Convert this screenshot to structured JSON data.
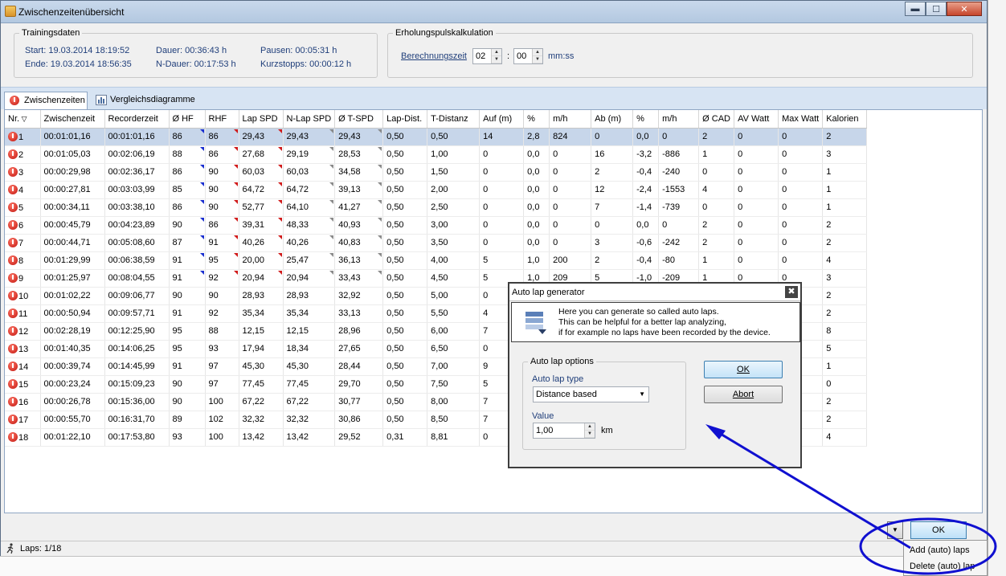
{
  "window": {
    "title": "Zwischenzeitenübersicht"
  },
  "training": {
    "legend": "Trainingsdaten",
    "start": "Start: 19.03.2014 18:19:52",
    "ende": "Ende: 19.03.2014 18:56:35",
    "dauer": "Dauer: 00:36:43 h",
    "ndauer": "N-Dauer: 00:17:53 h",
    "pausen": "Pausen: 00:05:31 h",
    "kurzstopps": "Kurzstopps: 00:00:12 h"
  },
  "erholung": {
    "legend": "Erholungspulskalkulation",
    "label": "Berechnungszeit",
    "min": "02",
    "sep": ":",
    "sec": "00",
    "unit": "mm:ss"
  },
  "tabs": [
    "Zwischenzeiten",
    "Vergleichsdiagramme"
  ],
  "columns": [
    "Nr.",
    "Zwischenzeit",
    "Recorderzeit",
    "Ø HF",
    "RHF",
    "Lap SPD",
    "N-Lap SPD",
    "Ø T-SPD",
    "Lap-Dist.",
    "T-Distanz",
    "Auf (m)",
    "%",
    "m/h",
    "Ab (m)",
    "%",
    "m/h",
    "Ø CAD",
    "AV Watt",
    "Max Watt",
    "Kalorien"
  ],
  "rows": [
    [
      "1",
      "00:01:01,16",
      "00:01:01,16",
      "86",
      "86",
      "29,43",
      "29,43",
      "29,43",
      "0,50",
      "0,50",
      "14",
      "2,8",
      "824",
      "0",
      "0,0",
      "0",
      "2",
      "0",
      "0",
      "2"
    ],
    [
      "2",
      "00:01:05,03",
      "00:02:06,19",
      "88",
      "86",
      "27,68",
      "29,19",
      "28,53",
      "0,50",
      "1,00",
      "0",
      "0,0",
      "0",
      "16",
      "-3,2",
      "-886",
      "1",
      "0",
      "0",
      "3"
    ],
    [
      "3",
      "00:00:29,98",
      "00:02:36,17",
      "86",
      "90",
      "60,03",
      "60,03",
      "34,58",
      "0,50",
      "1,50",
      "0",
      "0,0",
      "0",
      "2",
      "-0,4",
      "-240",
      "0",
      "0",
      "0",
      "1"
    ],
    [
      "4",
      "00:00:27,81",
      "00:03:03,99",
      "85",
      "90",
      "64,72",
      "64,72",
      "39,13",
      "0,50",
      "2,00",
      "0",
      "0,0",
      "0",
      "12",
      "-2,4",
      "-1553",
      "4",
      "0",
      "0",
      "1"
    ],
    [
      "5",
      "00:00:34,11",
      "00:03:38,10",
      "86",
      "90",
      "52,77",
      "64,10",
      "41,27",
      "0,50",
      "2,50",
      "0",
      "0,0",
      "0",
      "7",
      "-1,4",
      "-739",
      "0",
      "0",
      "0",
      "1"
    ],
    [
      "6",
      "00:00:45,79",
      "00:04:23,89",
      "90",
      "86",
      "39,31",
      "48,33",
      "40,93",
      "0,50",
      "3,00",
      "0",
      "0,0",
      "0",
      "0",
      "0,0",
      "0",
      "2",
      "0",
      "0",
      "2"
    ],
    [
      "7",
      "00:00:44,71",
      "00:05:08,60",
      "87",
      "91",
      "40,26",
      "40,26",
      "40,83",
      "0,50",
      "3,50",
      "0",
      "0,0",
      "0",
      "3",
      "-0,6",
      "-242",
      "2",
      "0",
      "0",
      "2"
    ],
    [
      "8",
      "00:01:29,99",
      "00:06:38,59",
      "91",
      "95",
      "20,00",
      "25,47",
      "36,13",
      "0,50",
      "4,00",
      "5",
      "1,0",
      "200",
      "2",
      "-0,4",
      "-80",
      "1",
      "0",
      "0",
      "4"
    ],
    [
      "9",
      "00:01:25,97",
      "00:08:04,55",
      "91",
      "92",
      "20,94",
      "20,94",
      "33,43",
      "0,50",
      "4,50",
      "5",
      "1,0",
      "209",
      "5",
      "-1,0",
      "-209",
      "1",
      "0",
      "0",
      "3"
    ],
    [
      "10",
      "00:01:02,22",
      "00:09:06,77",
      "90",
      "90",
      "28,93",
      "28,93",
      "32,92",
      "0,50",
      "5,00",
      "0",
      "",
      "",
      "",
      "",
      "",
      "",
      "",
      "",
      "2"
    ],
    [
      "11",
      "00:00:50,94",
      "00:09:57,71",
      "91",
      "92",
      "35,34",
      "35,34",
      "33,13",
      "0,50",
      "5,50",
      "4",
      "",
      "",
      "",
      "",
      "",
      "",
      "",
      "",
      "2"
    ],
    [
      "12",
      "00:02:28,19",
      "00:12:25,90",
      "95",
      "88",
      "12,15",
      "12,15",
      "28,96",
      "0,50",
      "6,00",
      "7",
      "",
      "",
      "",
      "",
      "",
      "",
      "",
      "",
      "8"
    ],
    [
      "13",
      "00:01:40,35",
      "00:14:06,25",
      "95",
      "93",
      "17,94",
      "18,34",
      "27,65",
      "0,50",
      "6,50",
      "0",
      "",
      "",
      "",
      "",
      "",
      "",
      "",
      "",
      "5"
    ],
    [
      "14",
      "00:00:39,74",
      "00:14:45,99",
      "91",
      "97",
      "45,30",
      "45,30",
      "28,44",
      "0,50",
      "7,00",
      "9",
      "",
      "",
      "",
      "",
      "",
      "",
      "",
      "",
      "1"
    ],
    [
      "15",
      "00:00:23,24",
      "00:15:09,23",
      "90",
      "97",
      "77,45",
      "77,45",
      "29,70",
      "0,50",
      "7,50",
      "5",
      "",
      "",
      "",
      "",
      "",
      "",
      "",
      "",
      "0"
    ],
    [
      "16",
      "00:00:26,78",
      "00:15:36,00",
      "90",
      "100",
      "67,22",
      "67,22",
      "30,77",
      "0,50",
      "8,00",
      "7",
      "",
      "",
      "",
      "",
      "",
      "",
      "",
      "",
      "2"
    ],
    [
      "17",
      "00:00:55,70",
      "00:16:31,70",
      "89",
      "102",
      "32,32",
      "32,32",
      "30,86",
      "0,50",
      "8,50",
      "7",
      "",
      "",
      "",
      "",
      "",
      "",
      "",
      "",
      "2"
    ],
    [
      "18",
      "00:01:22,10",
      "00:17:53,80",
      "93",
      "100",
      "13,42",
      "13,42",
      "29,52",
      "0,31",
      "8,81",
      "0",
      "",
      "",
      "",
      "",
      "",
      "",
      "",
      "",
      "4"
    ]
  ],
  "status": {
    "laps": "Laps: 1/18"
  },
  "ok_label": "OK",
  "context_menu": [
    "Add (auto) laps",
    "Delete (auto) lap"
  ],
  "dialog": {
    "title": "Auto lap generator",
    "close": "✖",
    "lines": [
      "Here you can generate so called auto laps.",
      "This can be helpful for a better lap analyzing,",
      "if for example no laps have been recorded by the device."
    ],
    "options_legend": "Auto lap options",
    "type_label": "Auto lap type",
    "type_value": "Distance based",
    "value_label": "Value",
    "value": "1,00",
    "unit": "km",
    "ok": "OK",
    "abort": "Abort"
  },
  "colors": {
    "annotation": "#1010d0",
    "selected_row": "#c7d6ea",
    "accent": "#3c7fb1"
  }
}
